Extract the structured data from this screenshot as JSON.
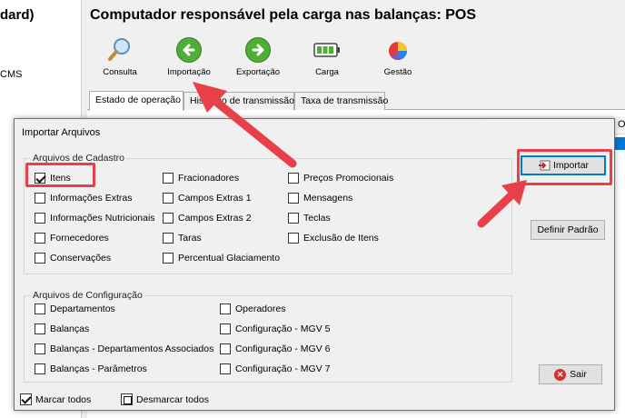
{
  "app": {
    "left_title": "dard)",
    "left_item": "CMS",
    "window_title": "Computador responsável pela carga nas balanças: POS",
    "grid_header_letter": "O"
  },
  "toolbar": {
    "consulta": "Consulta",
    "importacao": "Importação",
    "exportacao": "Exportação",
    "carga": "Carga",
    "gestao": "Gestão"
  },
  "tabs": [
    "Estado de operação",
    "Histórico de transmissão",
    "Taxa de transmissão"
  ],
  "dialog": {
    "title": "Importar Arquivos",
    "cadastro_title": "Arquivos de Cadastro",
    "cadastro_items": [
      {
        "label": "Itens",
        "checked": true
      },
      {
        "label": "Informações Extras",
        "checked": false
      },
      {
        "label": "Informações Nutricionais",
        "checked": false
      },
      {
        "label": "Fornecedores",
        "checked": false
      },
      {
        "label": "Conservações",
        "checked": false
      },
      {
        "label": "Fracionadores",
        "checked": false
      },
      {
        "label": "Campos Extras 1",
        "checked": false
      },
      {
        "label": "Campos Extras 2",
        "checked": false
      },
      {
        "label": "Taras",
        "checked": false
      },
      {
        "label": "Percentual Glaciamento",
        "checked": false
      },
      {
        "label": "Preços Promocionais",
        "checked": false
      },
      {
        "label": "Mensagens",
        "checked": false
      },
      {
        "label": "Teclas",
        "checked": false
      },
      {
        "label": "Exclusão de Itens",
        "checked": false
      }
    ],
    "config_title": "Arquivos de Configuração",
    "config_items": [
      {
        "label": "Departamentos",
        "checked": false
      },
      {
        "label": "Balanças",
        "checked": false
      },
      {
        "label": "Balanças - Departamentos Associados",
        "checked": false
      },
      {
        "label": "Balanças - Parâmetros",
        "checked": false
      },
      {
        "label": "Operadores",
        "checked": false
      },
      {
        "label": "Configuração - MGV 5",
        "checked": false
      },
      {
        "label": "Configuração - MGV 6",
        "checked": false
      },
      {
        "label": "Configuração - MGV 7",
        "checked": false
      }
    ],
    "importar_button": "Importar",
    "definir_padrao_button": "Definir Padrão",
    "sair_button": "Sair",
    "marcar_todos": "Marcar todos",
    "desmarcar_todos": "Desmarcar todos"
  },
  "colors": {
    "highlight": "#e8404a",
    "selection": "#0078d7"
  }
}
